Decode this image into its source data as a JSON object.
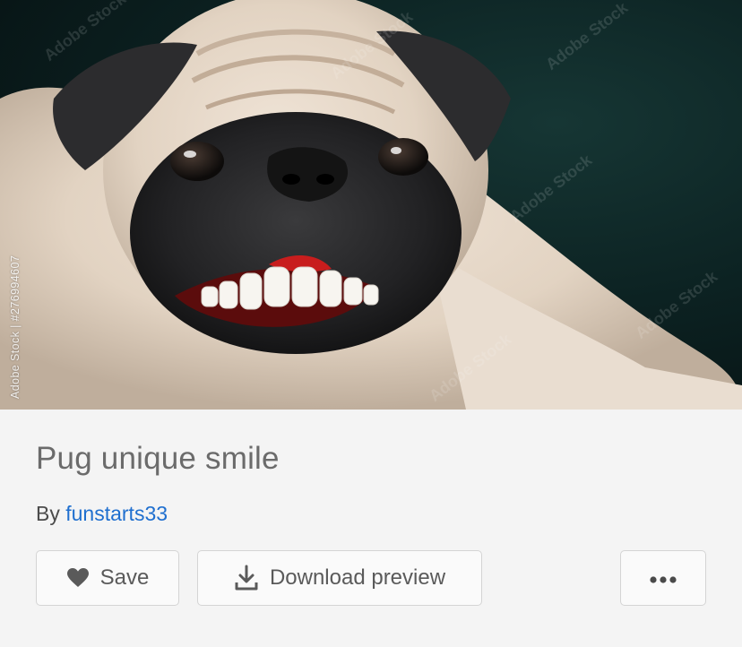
{
  "photo": {
    "alt": "Pug unique smile",
    "side_watermark": "Adobe Stock | #276994607",
    "tiled_watermark": "Adobe Stock"
  },
  "asset": {
    "title": "Pug unique smile",
    "by_prefix": "By",
    "author": "funstarts33"
  },
  "actions": {
    "save_label": "Save",
    "save_icon": "heart-icon",
    "download_label": "Download preview",
    "download_icon": "download-icon",
    "more_icon": "more-horizontal-icon"
  },
  "colors": {
    "link": "#1f6fcf",
    "title": "#6b6b6b",
    "background": "#f4f4f4"
  }
}
